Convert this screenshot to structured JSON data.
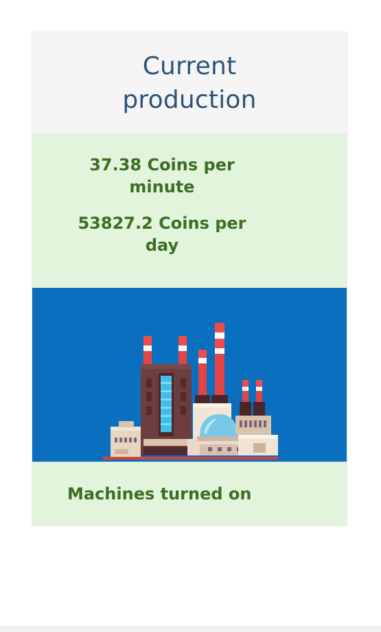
{
  "production": {
    "title": "Current production",
    "coins_per_minute": "37.38 Coins per minute",
    "coins_per_day": "53827.2 Coins per day"
  },
  "factory_image": {
    "icon": "factory-illustration"
  },
  "machines": {
    "label": "Machines turned on"
  },
  "colors": {
    "title_text": "#2f5377",
    "stats_text": "#3c6e24",
    "stats_background": "#e3f4dc",
    "header_background": "#f5f5f5",
    "image_background": "#0b6fc0"
  }
}
